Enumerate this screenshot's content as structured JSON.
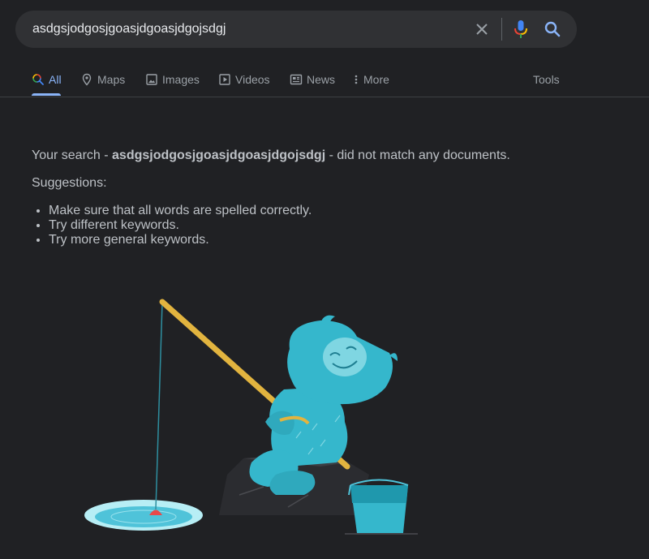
{
  "search": {
    "query": "asdgsjodgosjgoasjdgoasjdgojsdgj"
  },
  "icons": {
    "clear": "close-icon",
    "mic": "microphone-icon",
    "search": "search-icon"
  },
  "tabs": [
    {
      "label": "All",
      "icon": "search-icon",
      "active": true
    },
    {
      "label": "Maps",
      "icon": "map-pin-icon"
    },
    {
      "label": "Images",
      "icon": "image-icon"
    },
    {
      "label": "Videos",
      "icon": "play-icon"
    },
    {
      "label": "News",
      "icon": "newspaper-icon"
    },
    {
      "label": "More",
      "icon": "more-vert-icon"
    }
  ],
  "tools_label": "Tools",
  "results": {
    "message_prefix": "Your search - ",
    "message_query": "asdgsjodgosjgoasjdgoasjdgojsdgj",
    "message_suffix": " - did not match any documents.",
    "suggestions_title": "Suggestions:",
    "suggestions": [
      "Make sure that all words are spelled correctly.",
      "Try different keywords.",
      "Try more general keywords."
    ]
  },
  "colors": {
    "background": "#202124",
    "search_box": "#303134",
    "accent": "#8ab4f8",
    "text": "#bdc1c6",
    "muted": "#9aa0a6"
  },
  "illustration": "yeti-ice-fishing-illustration"
}
